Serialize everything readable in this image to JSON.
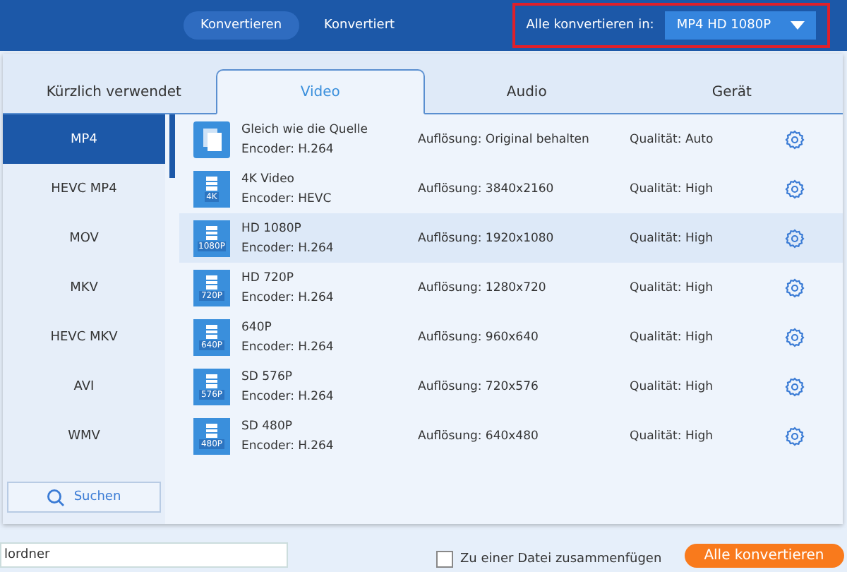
{
  "top_tabs": [
    {
      "label": "Konvertieren",
      "selected": true
    },
    {
      "label": "Konvertiert",
      "selected": false
    }
  ],
  "convert_all": {
    "label": "Alle konvertieren in:",
    "value": "MP4 HD 1080P",
    "highlighted": true
  },
  "format_tabs": [
    {
      "label": "Kürzlich verwendet",
      "selected": false
    },
    {
      "label": "Video",
      "selected": true
    },
    {
      "label": "Audio",
      "selected": false
    },
    {
      "label": "Gerät",
      "selected": false
    }
  ],
  "formats": [
    {
      "label": "MP4",
      "selected": true
    },
    {
      "label": "HEVC MP4",
      "selected": false
    },
    {
      "label": "MOV",
      "selected": false
    },
    {
      "label": "MKV",
      "selected": false
    },
    {
      "label": "HEVC MKV",
      "selected": false
    },
    {
      "label": "AVI",
      "selected": false
    },
    {
      "label": "WMV",
      "selected": false
    }
  ],
  "search_button": "Suchen",
  "presets": [
    {
      "kind": "source",
      "name": "Gleich wie die Quelle",
      "encoder": "Encoder: H.264",
      "resolution": "Auflösung: Original behalten",
      "quality": "Qualität: Auto",
      "selected": false
    },
    {
      "kind": "video",
      "badge": "4K",
      "name": "4K Video",
      "encoder": "Encoder: HEVC",
      "resolution": "Auflösung: 3840x2160",
      "quality": "Qualität: High",
      "selected": false
    },
    {
      "kind": "video",
      "badge": "1080P",
      "name": "HD 1080P",
      "encoder": "Encoder: H.264",
      "resolution": "Auflösung: 1920x1080",
      "quality": "Qualität: High",
      "selected": true
    },
    {
      "kind": "video",
      "badge": "720P",
      "name": "HD 720P",
      "encoder": "Encoder: H.264",
      "resolution": "Auflösung: 1280x720",
      "quality": "Qualität: High",
      "selected": false
    },
    {
      "kind": "video",
      "badge": "640P",
      "name": "640P",
      "encoder": "Encoder: H.264",
      "resolution": "Auflösung: 960x640",
      "quality": "Qualität: High",
      "selected": false
    },
    {
      "kind": "video",
      "badge": "576P",
      "name": "SD 576P",
      "encoder": "Encoder: H.264",
      "resolution": "Auflösung: 720x576",
      "quality": "Qualität: High",
      "selected": false
    },
    {
      "kind": "video",
      "badge": "480P",
      "name": "SD 480P",
      "encoder": "Encoder: H.264",
      "resolution": "Auflösung: 640x480",
      "quality": "Qualität: High",
      "selected": false
    }
  ],
  "bottom_bar": {
    "folder": "lordner",
    "merge_label": "Zu einer Datei zusammenfügen",
    "merge_checked": false,
    "convert_button": "Alle konvertieren"
  }
}
